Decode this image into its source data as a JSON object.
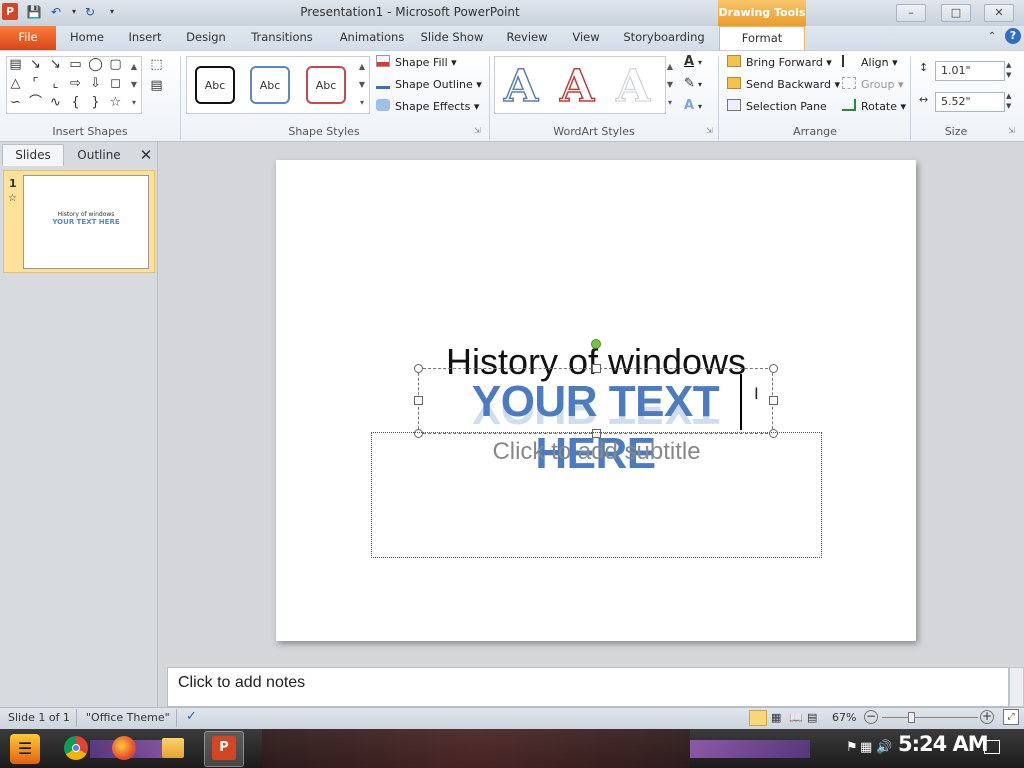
{
  "window": {
    "title": "Presentation1 - Microsoft PowerPoint",
    "context_tab": "Drawing Tools"
  },
  "app_icon": "P",
  "tabs": [
    "Insert",
    "Design",
    "Transitions",
    "Animations",
    "Slide Show",
    "Review",
    "View",
    "Storyboarding"
  ],
  "home_tab": "Home",
  "file_tab": "File",
  "active_tab": "Format",
  "ribbon": {
    "groups": {
      "insert_shapes": "Insert Shapes",
      "shape_styles": "Shape Styles",
      "wordart_styles": "WordArt Styles",
      "arrange": "Arrange",
      "size": "Size"
    },
    "style_samples": [
      "Abc",
      "Abc",
      "Abc"
    ],
    "shape_fill": "Shape Fill",
    "shape_outline": "Shape Outline",
    "shape_effects": "Shape Effects",
    "bring_forward": "Bring Forward",
    "send_backward": "Send Backward",
    "selection_pane": "Selection Pane",
    "align": "Align",
    "group": "Group",
    "rotate": "Rotate",
    "height": "1.01\"",
    "width": "5.52\""
  },
  "panel": {
    "slides_tab": "Slides",
    "outline_tab": "Outline",
    "slide_number": "1",
    "thumb_title": "History of windows",
    "thumb_wordart": "YOUR TEXT HERE"
  },
  "slide": {
    "title": "History of windows",
    "wordart": "YOUR TEXT HERE",
    "subtitle_placeholder": "Click to add subtitle"
  },
  "notes_placeholder": "Click to add notes",
  "status": {
    "slide_info": "Slide 1 of 1",
    "theme": "\"Office Theme\"",
    "zoom": "67%"
  },
  "taskbar": {
    "clock": "5:24 AM"
  },
  "colors": {
    "accent": "#f0a030",
    "file_tab": "#d5471b",
    "wordart": "#4c7cc0"
  }
}
